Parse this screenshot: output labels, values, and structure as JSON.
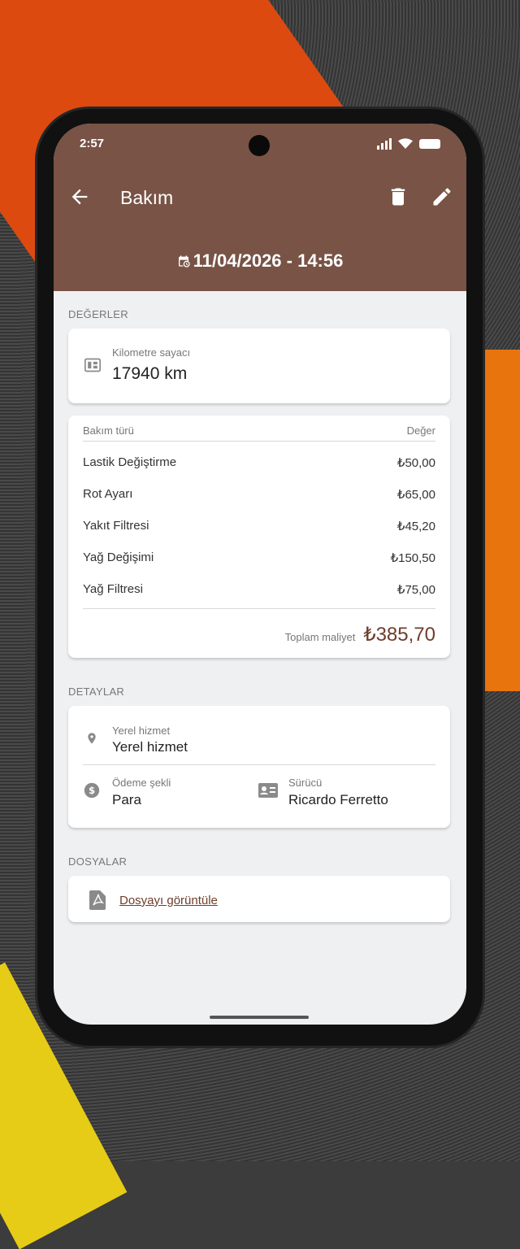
{
  "status_bar": {
    "time": "2:57"
  },
  "app_bar": {
    "title": "Bakım",
    "datetime": "11/04/2026 - 14:56",
    "accent_color": "#785346"
  },
  "values_section": {
    "header": "DEĞERLER",
    "odometer": {
      "label": "Kilometre sayacı",
      "value": "17940 km"
    },
    "table": {
      "col_type": "Bakım türü",
      "col_value": "Değer",
      "rows": [
        {
          "type": "Lastik Değiştirme",
          "value": "₺50,00"
        },
        {
          "type": "Rot Ayarı",
          "value": "₺65,00"
        },
        {
          "type": "Yakıt Filtresi",
          "value": "₺45,20"
        },
        {
          "type": "Yağ Değişimi",
          "value": "₺150,50"
        },
        {
          "type": "Yağ Filtresi",
          "value": "₺75,00"
        }
      ],
      "total_label": "Toplam maliyet",
      "total_value": "₺385,70"
    }
  },
  "details_section": {
    "header": "DETAYLAR",
    "service": {
      "label": "Yerel hizmet",
      "value": "Yerel hizmet"
    },
    "payment": {
      "label": "Ödeme şekli",
      "value": "Para"
    },
    "driver": {
      "label": "Sürücü",
      "value": "Ricardo Ferretto"
    }
  },
  "files_section": {
    "header": "DOSYALAR",
    "link": "Dosyayı görüntüle"
  },
  "icons": [
    "back-arrow-icon",
    "trash-icon",
    "edit-pencil-icon",
    "calendar-clock-icon",
    "odometer-icon",
    "location-pin-icon",
    "dollar-circle-icon",
    "id-card-icon",
    "pdf-file-icon"
  ]
}
